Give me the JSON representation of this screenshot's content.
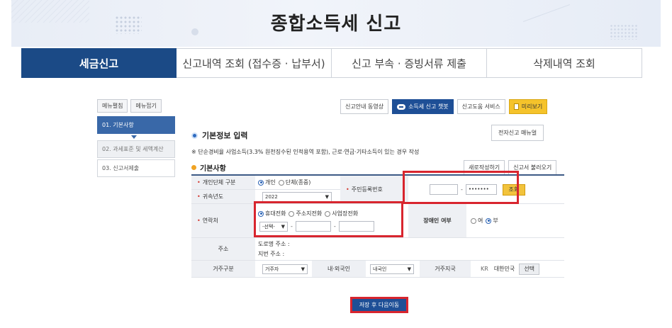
{
  "banner": {
    "title": "종합소득세 신고"
  },
  "tabs": [
    {
      "label": "세금신고"
    },
    {
      "label": "신고내역 조회 (접수증 · 납부서)"
    },
    {
      "label": "신고 부속 · 증빙서류 제출"
    },
    {
      "label": "삭제내역 조회"
    }
  ],
  "left_menu": {
    "expand_label": "메뉴펼침",
    "collapse_label": "메뉴접기",
    "items": [
      {
        "label": "01. 기본사항"
      },
      {
        "label": "02. 과세표준 및 세액계산"
      },
      {
        "label": "03. 신고서제출"
      }
    ]
  },
  "toolbar": {
    "guide_video": "신고안내 동영상",
    "chatbot": "소득세 신고 챗봇",
    "help_service": "신고도움 서비스",
    "preview": "미리보기"
  },
  "manual_button": "전자신고 매뉴얼",
  "section": {
    "title": "기본정보 입력",
    "note": "※ 단순경비율 사업소득(3.3% 원천징수된 인적용역 포함), 근로·연금·기타소득이 있는 경우 작성",
    "subtitle": "기본사항",
    "rewrite_button": "새로작성하기",
    "load_button": "신고서 불러오기"
  },
  "form": {
    "entity_label": "개인단체 구분",
    "entity_opt1": "개인",
    "entity_opt2": "단체(종중)",
    "year_label": "귀속년도",
    "year_value": "2022",
    "rrn_label": "주민등록번호",
    "rrn_front": "",
    "rrn_back": "•••••••",
    "lookup_button": "조회",
    "contact_label": "연락처",
    "contact_opt1": "휴대전화",
    "contact_opt2": "주소지전화",
    "contact_opt3": "사업장전화",
    "contact_select": "-선택-",
    "disabled_label": "장애인 여부",
    "disabled_yes": "여",
    "disabled_no": "부",
    "address_label": "주소",
    "road_address": "도로명 주소 :",
    "lot_address": "지번 주소 :",
    "residence_label": "거주구분",
    "residence_value": "거주자",
    "nationality_label": "내·외국인",
    "nationality_value": "내국인",
    "country_label": "거주지국",
    "country_code": "KR",
    "country_name": "대한민국",
    "select_button": "선택"
  },
  "submit_button": "저장 후 다음이동",
  "colors": {
    "primary": "#1b4a86",
    "highlight": "#d8252e",
    "gold": "#f2c33c"
  }
}
